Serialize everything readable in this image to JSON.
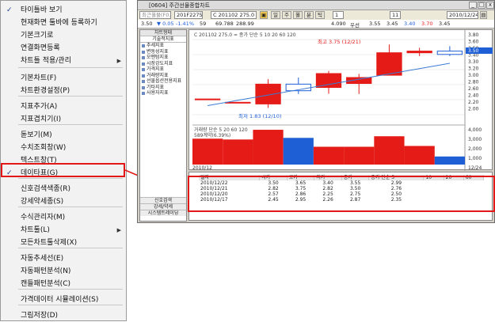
{
  "menu": {
    "items": [
      {
        "label": "타이틀바 보기",
        "checked": true
      },
      {
        "label": "현재화면 툴바에 등록하기"
      },
      {
        "label": "기본크기로"
      },
      {
        "label": "연결화면등록"
      },
      {
        "label": "차트틀 적용/관리",
        "submenu": true
      },
      {
        "label": "기본차트(F)"
      },
      {
        "label": "차트환경설정(P)"
      },
      {
        "label": "지표추가(A)"
      },
      {
        "label": "지표겹치기(I)"
      },
      {
        "label": "돋보기(M)"
      },
      {
        "label": "수치조회창(W)"
      },
      {
        "label": "텍스트창(T)"
      },
      {
        "label": "데이타표(G)",
        "checked": true
      },
      {
        "label": "신호검색색종(R)"
      },
      {
        "label": "강세약세종(S)"
      },
      {
        "label": "수식관리자(M)"
      },
      {
        "label": "차트툴(L)",
        "submenu": true
      },
      {
        "label": "모든차트툴삭제(X)"
      },
      {
        "label": "자동추세선(E)"
      },
      {
        "label": "자동패턴분석(N)"
      },
      {
        "label": "캔들패턴분석(C)"
      },
      {
        "label": "가격데이터 시뮬레이션(S)"
      },
      {
        "label": "그림저장(D)"
      }
    ]
  },
  "window": {
    "title": "[0604] 주간선물종합차트",
    "toolbar": {
      "search_value": "최근월물(F0.18)",
      "code": "201F2275",
      "price_field": "C 201102 275.0",
      "period_buttons": [
        "일",
        "주",
        "월",
        "분",
        "틱"
      ],
      "count": "1",
      "page": "11",
      "date": "2010/12/24"
    },
    "quote": {
      "price": "3.50",
      "change": "0.05",
      "rate": "-1.41%",
      "bid": "59",
      "ask": "69.788",
      "vol": "288.99",
      "open": "4.090",
      "label_u": "우선",
      "h": "3.55",
      "l": "3.45",
      "c": "3.40",
      "d": "3.70",
      "e": "3.45"
    },
    "sidebar": {
      "header": "차트형태",
      "section": "기술적지표",
      "items": [
        "추세지표",
        "변동성지표",
        "모멘텀지표",
        "시장강도지표",
        "가격지표",
        "거래량지표",
        "선물옵션전용지표",
        "기타지표",
        "사용자지표"
      ],
      "bottom": [
        "신호검색",
        "강세/약세",
        "시스템트레이딩"
      ]
    },
    "chart": {
      "legend": "C 201102 275.0 = 종가 단순 5 10 20 60 120",
      "annotation_high": "최고 3.75 (12/21)",
      "annotation_low": "최저 1.83 (12/10)",
      "price_axis": [
        "3.80",
        "3.60",
        "3.50",
        "3.40",
        "3.30",
        "3.20",
        "3.00",
        "2.80",
        "2.60",
        "2.40",
        "2.20",
        "2.00"
      ],
      "current_label": "3.50",
      "volume_legend": "거래량 단순 5 20 60 120",
      "volume_value": "589계약(6.39%)",
      "volume_axis": [
        "4,000",
        "3,000",
        "2,000",
        "1,000"
      ],
      "x_left": "2010/12",
      "x_right": "12/24"
    },
    "data_table": {
      "headers": [
        "일자",
        "시가",
        "고가",
        "저가",
        "종가",
        "종가 단순 5",
        "10",
        "20",
        "60"
      ],
      "rows": [
        [
          "2010/12/22",
          "3.50",
          "3.65",
          "3.40",
          "3.55",
          "2.99",
          "",
          "",
          ""
        ],
        [
          "2010/12/21",
          "2.82",
          "3.75",
          "2.82",
          "3.50",
          "2.76",
          "",
          "",
          ""
        ],
        [
          "2010/12/20",
          "2.57",
          "2.86",
          "2.25",
          "2.75",
          "2.50",
          "",
          "",
          ""
        ],
        [
          "2010/12/17",
          "2.45",
          "2.95",
          "2.26",
          "2.87",
          "2.35",
          "",
          "",
          ""
        ]
      ]
    }
  },
  "colors": {
    "highlight": "#e21818",
    "up": "#e41b17",
    "down": "#1f5fd6"
  },
  "chart_data": {
    "type": "bar",
    "title": "",
    "candles": [
      {
        "o": 2.1,
        "c": 2.1,
        "h": 2.1,
        "l": 2.1
      },
      {
        "o": 2.0,
        "c": 2.0,
        "h": 2.0,
        "l": 2.0
      },
      {
        "o": 1.95,
        "c": 2.55,
        "h": 2.7,
        "l": 1.83
      },
      {
        "o": 2.55,
        "c": 2.35,
        "h": 2.75,
        "l": 2.25
      },
      {
        "o": 2.45,
        "c": 2.87,
        "h": 2.95,
        "l": 2.26
      },
      {
        "o": 2.57,
        "c": 2.75,
        "h": 2.86,
        "l": 2.25
      },
      {
        "o": 2.82,
        "c": 3.5,
        "h": 3.75,
        "l": 2.82
      },
      {
        "o": 3.5,
        "c": 3.55,
        "h": 3.65,
        "l": 3.4
      },
      {
        "o": 3.55,
        "c": 3.45,
        "h": 3.7,
        "l": 3.4
      }
    ],
    "volume": [
      3200,
      3100,
      4300,
      3300,
      2200,
      2200,
      3500,
      2300,
      1000
    ],
    "ylim": [
      1.6,
      3.9
    ]
  }
}
